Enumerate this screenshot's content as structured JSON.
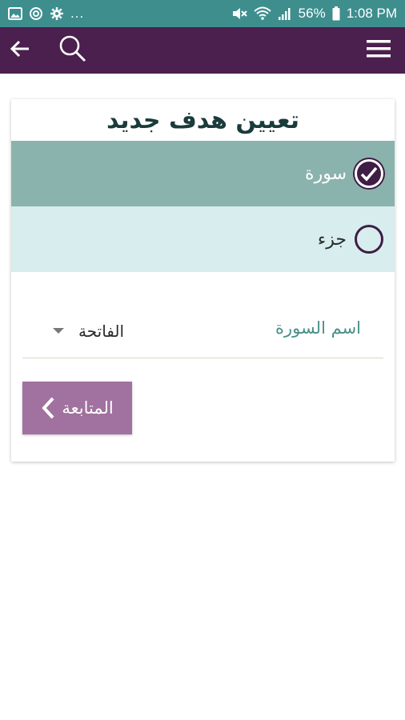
{
  "status_bar": {
    "left_icons": [
      "image-icon",
      "sync-icon",
      "settings-icon"
    ],
    "dots": "...",
    "right_icons": [
      "mute-icon",
      "wifi-icon",
      "signal-icon"
    ],
    "battery": "56%",
    "time": "1:08 PM"
  },
  "app_bar": {
    "back_icon": "back-arrow-icon",
    "search_icon": "search-icon",
    "menu_icon": "hamburger-menu-icon"
  },
  "card": {
    "title": "تعيين هدف جديد",
    "options": [
      {
        "label": "سورة",
        "selected": true
      },
      {
        "label": "جزء",
        "selected": false
      }
    ],
    "field": {
      "label": "اسم السورة",
      "value": "الفاتحة"
    },
    "continue_label": "المتابعة"
  },
  "colors": {
    "status_bar": "#3e8e8e",
    "app_bar": "#4b1f4e",
    "option_selected": "#8bb3ad",
    "option_unselected": "#d7edee",
    "button": "#a1719f"
  }
}
